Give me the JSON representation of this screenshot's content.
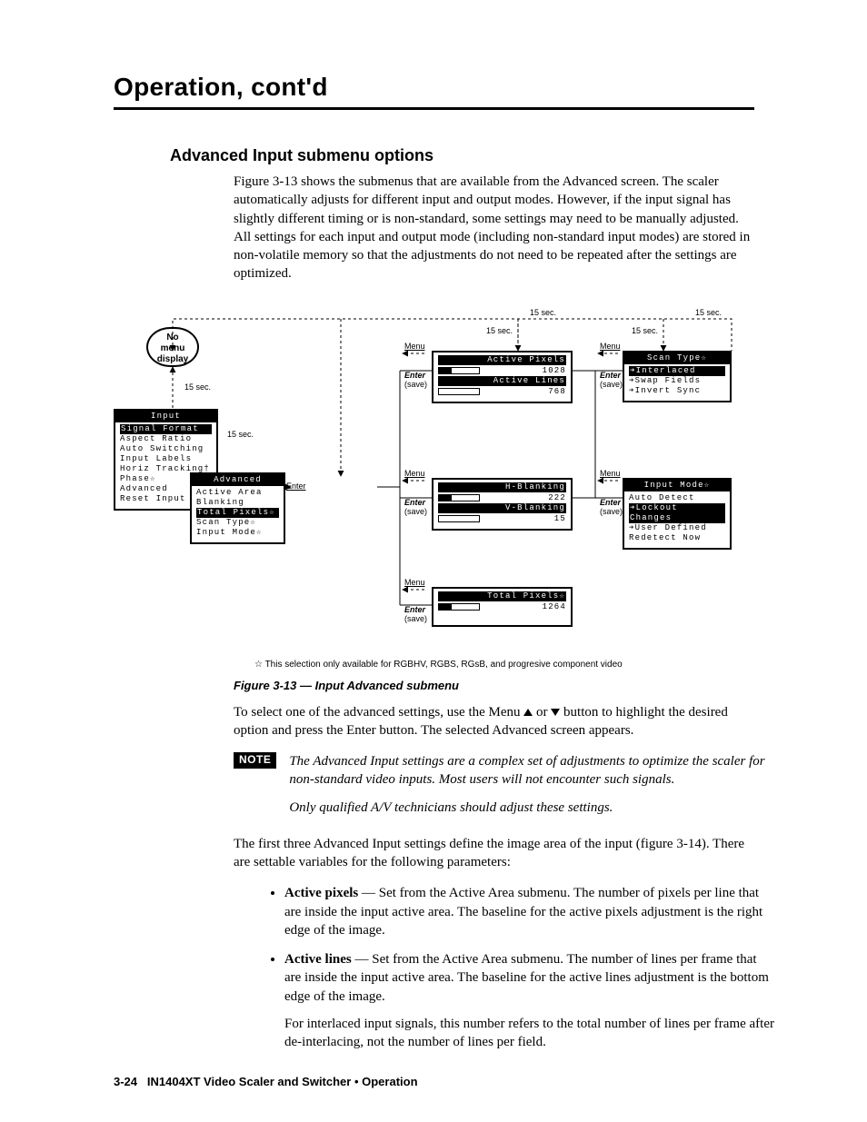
{
  "chapter_title": "Operation, cont'd",
  "section_title": "Advanced Input submenu options",
  "intro_para": "Figure 3-13 shows the submenus that are available from the Advanced screen.  The scaler automatically adjusts for different input and output modes.  However, if the input signal has slightly different timing or is non-standard, some settings may need to be manually adjusted.  All settings for each input and output mode (including non-standard input modes) are stored in non-volatile memory so that the adjustments do not need to be repeated after the settings are optimized.",
  "figure": {
    "no_menu": "No\nmenu\ndisplay",
    "timeout": "15 sec.",
    "nav": {
      "menu": "Menu",
      "enter": "Enter",
      "save": "(save)"
    },
    "input_menu": {
      "title": "Input",
      "items": [
        "Signal Format",
        "Aspect Ratio",
        "Auto Switching",
        "Input Labels",
        "Horiz Tracking†",
        "Phase☆",
        "Advanced",
        "Reset Input"
      ]
    },
    "advanced_menu": {
      "title": "Advanced",
      "items": [
        "Active Area",
        "Blanking",
        "Total Pixels☆",
        "Scan Type☆",
        "Input Mode☆"
      ]
    },
    "active_area": {
      "px_label": "Active Pixels",
      "px_value": "1028",
      "ln_label": "Active Lines",
      "ln_value": "768"
    },
    "blanking": {
      "h_label": "H-Blanking",
      "h_value": "222",
      "v_label": "V-Blanking",
      "v_value": "15"
    },
    "total_pixels": {
      "label": "Total Pixels☆",
      "value": "1264"
    },
    "scan_type": {
      "title": "Scan Type☆",
      "items": [
        "➔Interlaced",
        "➔Swap Fields",
        "➔Invert Sync"
      ]
    },
    "input_mode": {
      "title": "Input Mode☆",
      "items": [
        "Auto Detect",
        "➔Lockout Changes",
        "➔User Defined",
        "Redetect Now"
      ]
    },
    "starnote": "☆  This selection only available for RGBHV, RGBS, RGsB, and progresive component video"
  },
  "figure_caption": "Figure 3-13 — Input Advanced submenu",
  "select_para_pre": "To select one of the advanced settings, use the Menu ",
  "select_para_mid": " or ",
  "select_para_post": " button to highlight the desired option and press the Enter button.  The selected Advanced screen appears.",
  "note": {
    "label": "NOTE",
    "p1": "The Advanced Input settings are a complex set of adjustments to optimize the scaler for non-standard video inputs.  Most users will not encounter such signals.",
    "p2": "Only qualified A/V technicians should adjust these settings."
  },
  "after_note_para": "The first three Advanced Input settings define the image area of the input (figure 3-14).  There are settable variables for the following parameters:",
  "bullets": {
    "b1_strong": "Active pixels",
    "b1_text": " — Set from the Active Area submenu.  The number of pixels per line that are inside the input active area.  The baseline for the active pixels adjustment is the right edge of the image.",
    "b2_strong": "Active lines",
    "b2_text": " — Set from the Active Area submenu.  The number of lines per frame that are inside the input active area.  The baseline for the active lines adjustment is the bottom edge of the image.",
    "b2_extra": "For interlaced input signals, this number refers to the total number of lines per frame after de-interlacing, not the number of lines per field."
  },
  "footer": {
    "page": "3-24",
    "text": "IN1404XT Video Scaler and Switcher • Operation"
  }
}
